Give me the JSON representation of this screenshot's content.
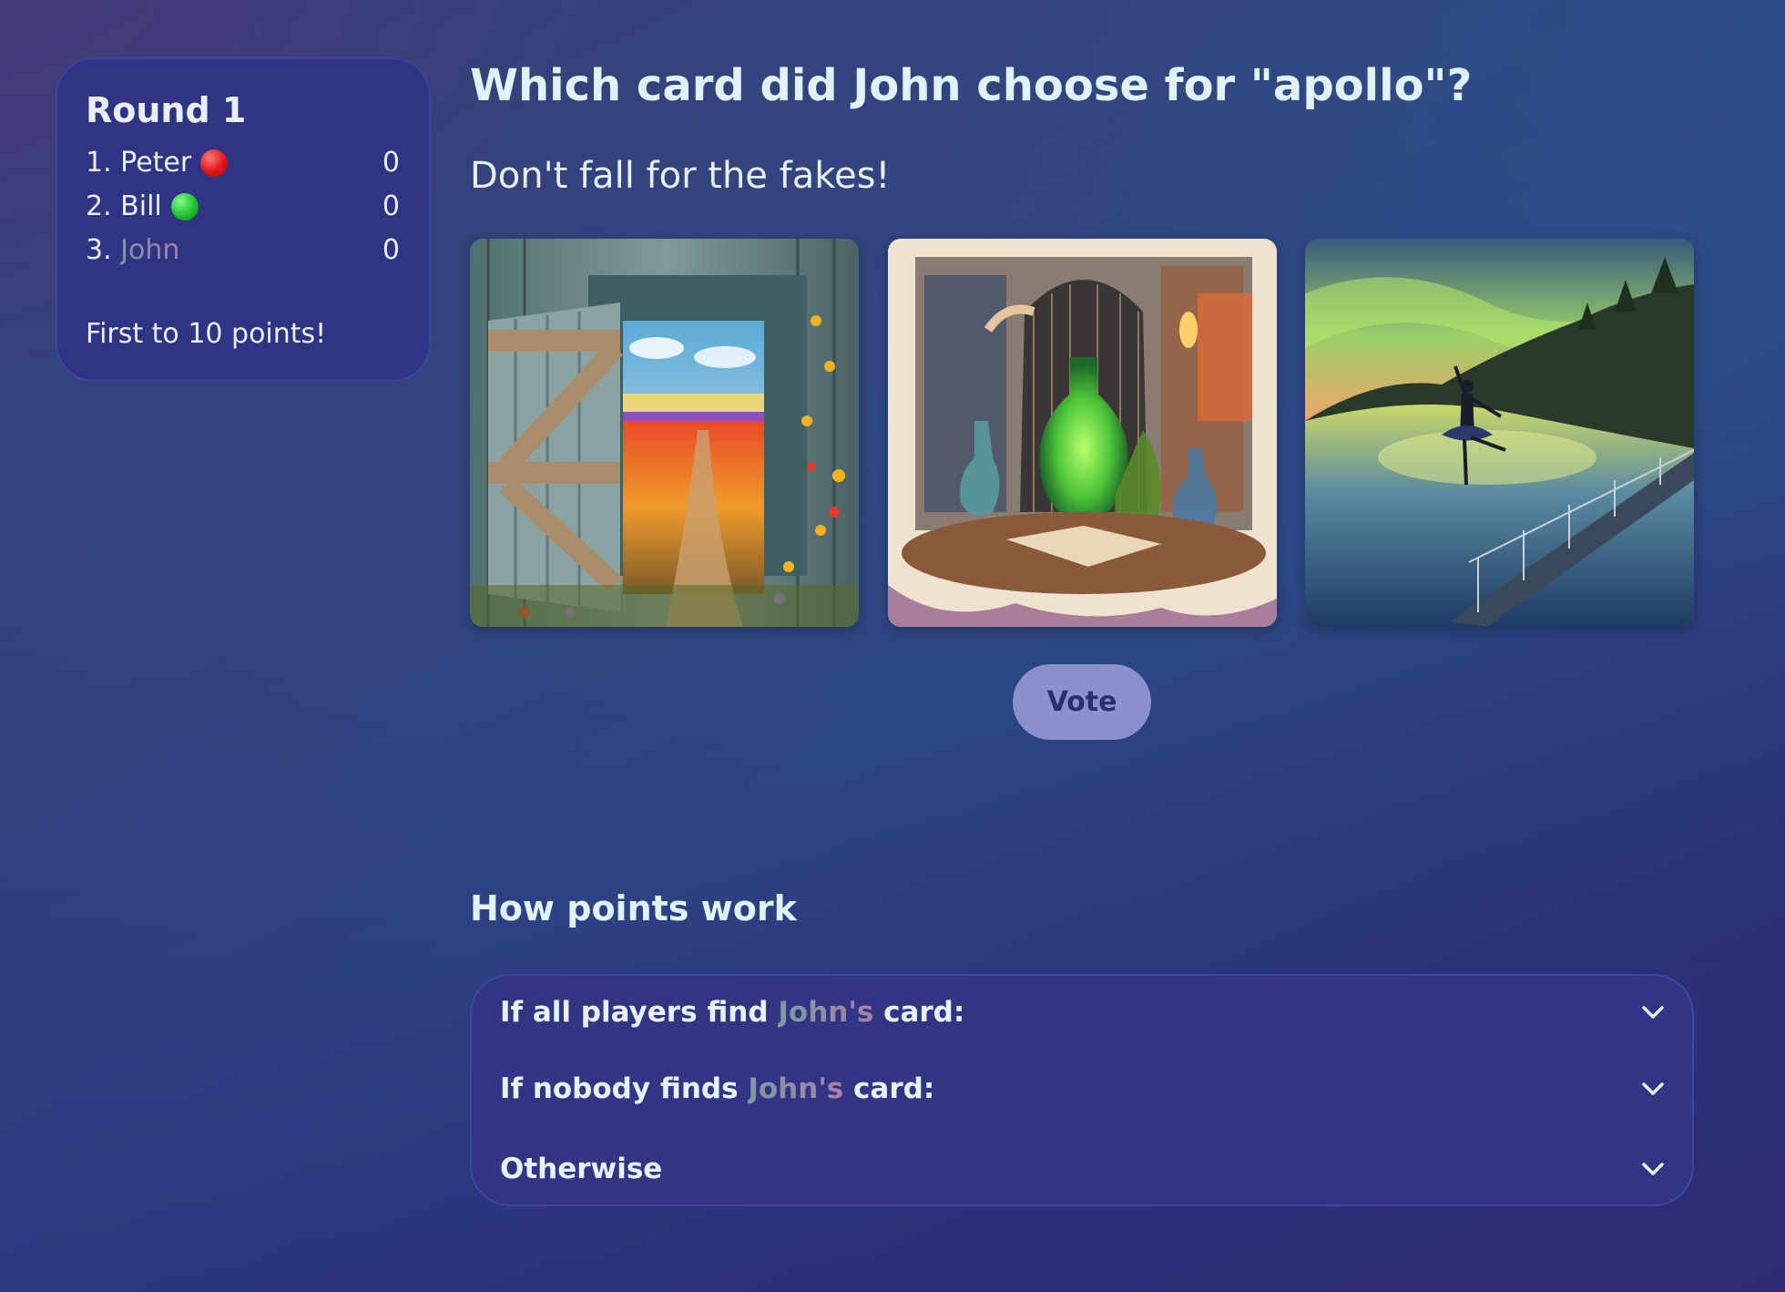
{
  "scoreboard": {
    "round_title": "Round 1",
    "players": [
      {
        "rank": "1.",
        "name": "Peter",
        "score": "0",
        "marker": "red-circle"
      },
      {
        "rank": "2.",
        "name": "Bill",
        "score": "0",
        "marker": "green-circle"
      },
      {
        "rank": "3.",
        "name": "John",
        "score": "0",
        "marker": "none"
      }
    ],
    "goal_text": "First to 10 points!"
  },
  "main": {
    "question": "Which card did John choose for \"apollo\"?",
    "subtitle": "Don't fall for the fakes!",
    "cards": [
      {
        "subject": "open barn door onto a flower field"
      },
      {
        "subject": "alchemy bottles and glowing flask in a birdcage"
      },
      {
        "subject": "ballerina on a pier under northern lights"
      }
    ],
    "vote_label": "Vote"
  },
  "points": {
    "heading": "How points work",
    "items": [
      {
        "prefix": "If all players find ",
        "name": "John's",
        "suffix": " card:"
      },
      {
        "prefix": "If nobody finds ",
        "name": "John's",
        "suffix": " card:"
      },
      {
        "prefix": "Otherwise",
        "name": "",
        "suffix": ""
      }
    ]
  },
  "colors": {
    "panel": "#2f3484",
    "vote_button": "#8a90cc",
    "name_gradient": [
      "#7a9aa4",
      "#a880a8"
    ]
  }
}
